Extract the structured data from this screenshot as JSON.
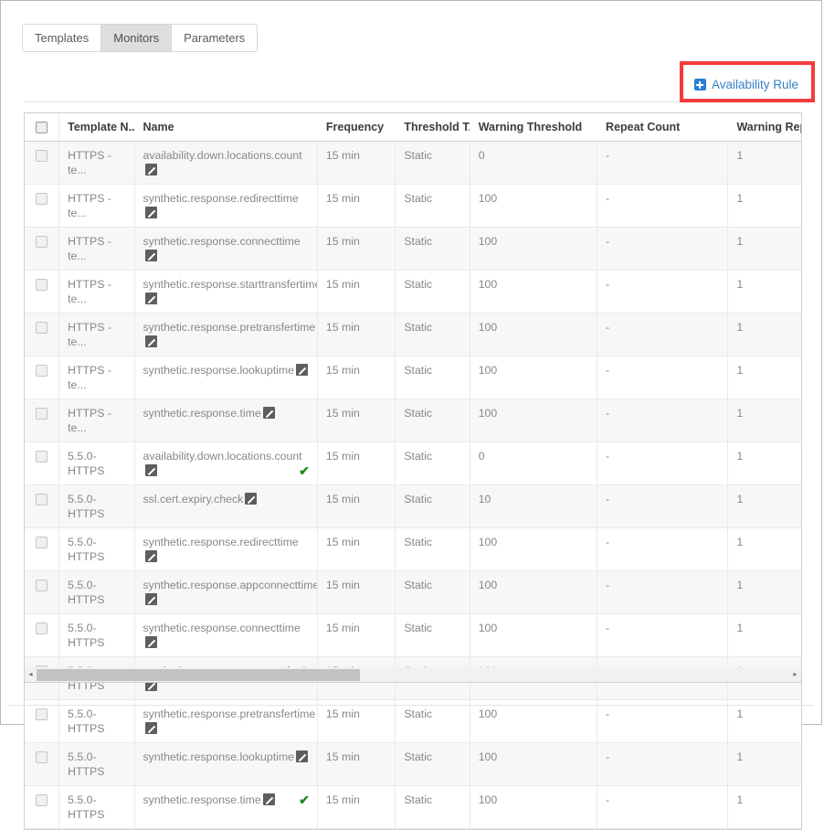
{
  "tabs": [
    {
      "label": "Templates",
      "active": false
    },
    {
      "label": "Monitors",
      "active": true
    },
    {
      "label": "Parameters",
      "active": false
    }
  ],
  "toolbar": {
    "availability_rule_label": "Availability Rule",
    "plus_icon": "plus-square-icon",
    "highlight_color": "#f53b3b",
    "link_color": "#3680c4"
  },
  "table": {
    "columns": [
      {
        "key": "checkbox",
        "label": ""
      },
      {
        "key": "template_name",
        "label": "Template N..."
      },
      {
        "key": "name",
        "label": "Name"
      },
      {
        "key": "frequency",
        "label": "Frequency"
      },
      {
        "key": "threshold_type",
        "label": "Threshold T..."
      },
      {
        "key": "warning_threshold",
        "label": "Warning Threshold"
      },
      {
        "key": "repeat_count",
        "label": "Repeat Count"
      },
      {
        "key": "warning_repeat_count",
        "label": "Warning Repeat C"
      }
    ],
    "rows": [
      {
        "template_name": "HTTPS - te...",
        "name": "availability.down.locations.count",
        "frequency": "15 min",
        "threshold_type": "Static",
        "warning_threshold": "0",
        "repeat_count": "-",
        "warning_repeat_count": "1",
        "checked": false,
        "verified": false
      },
      {
        "template_name": "HTTPS - te...",
        "name": "synthetic.response.redirecttime",
        "frequency": "15 min",
        "threshold_type": "Static",
        "warning_threshold": "100",
        "repeat_count": "-",
        "warning_repeat_count": "1",
        "checked": false,
        "verified": false
      },
      {
        "template_name": "HTTPS - te...",
        "name": "synthetic.response.connecttime",
        "frequency": "15 min",
        "threshold_type": "Static",
        "warning_threshold": "100",
        "repeat_count": "-",
        "warning_repeat_count": "1",
        "checked": false,
        "verified": false
      },
      {
        "template_name": "HTTPS - te...",
        "name": "synthetic.response.starttransfertime",
        "frequency": "15 min",
        "threshold_type": "Static",
        "warning_threshold": "100",
        "repeat_count": "-",
        "warning_repeat_count": "1",
        "checked": false,
        "verified": false
      },
      {
        "template_name": "HTTPS - te...",
        "name": "synthetic.response.pretransfertime",
        "frequency": "15 min",
        "threshold_type": "Static",
        "warning_threshold": "100",
        "repeat_count": "-",
        "warning_repeat_count": "1",
        "checked": false,
        "verified": false
      },
      {
        "template_name": "HTTPS - te...",
        "name": "synthetic.response.lookuptime",
        "frequency": "15 min",
        "threshold_type": "Static",
        "warning_threshold": "100",
        "repeat_count": "-",
        "warning_repeat_count": "1",
        "checked": false,
        "verified": false
      },
      {
        "template_name": "HTTPS - te...",
        "name": "synthetic.response.time",
        "frequency": "15 min",
        "threshold_type": "Static",
        "warning_threshold": "100",
        "repeat_count": "-",
        "warning_repeat_count": "1",
        "checked": false,
        "verified": false
      },
      {
        "template_name": "5.5.0-HTTPS",
        "name": "availability.down.locations.count",
        "frequency": "15 min",
        "threshold_type": "Static",
        "warning_threshold": "0",
        "repeat_count": "-",
        "warning_repeat_count": "1",
        "checked": false,
        "verified": true,
        "verified_position": "below"
      },
      {
        "template_name": "5.5.0-HTTPS",
        "name": "ssl.cert.expiry.check",
        "frequency": "15 min",
        "threshold_type": "Static",
        "warning_threshold": "10",
        "repeat_count": "-",
        "warning_repeat_count": "1",
        "checked": false,
        "verified": false
      },
      {
        "template_name": "5.5.0-HTTPS",
        "name": "synthetic.response.redirecttime",
        "frequency": "15 min",
        "threshold_type": "Static",
        "warning_threshold": "100",
        "repeat_count": "-",
        "warning_repeat_count": "1",
        "checked": false,
        "verified": false
      },
      {
        "template_name": "5.5.0-HTTPS",
        "name": "synthetic.response.appconnecttime",
        "frequency": "15 min",
        "threshold_type": "Static",
        "warning_threshold": "100",
        "repeat_count": "-",
        "warning_repeat_count": "1",
        "checked": false,
        "verified": false
      },
      {
        "template_name": "5.5.0-HTTPS",
        "name": "synthetic.response.connecttime",
        "frequency": "15 min",
        "threshold_type": "Static",
        "warning_threshold": "100",
        "repeat_count": "-",
        "warning_repeat_count": "1",
        "checked": false,
        "verified": false
      },
      {
        "template_name": "5.5.0-HTTPS",
        "name": "synthetic.response.starttransfertime",
        "frequency": "15 min",
        "threshold_type": "Static",
        "warning_threshold": "100",
        "repeat_count": "-",
        "warning_repeat_count": "1",
        "checked": false,
        "verified": false
      },
      {
        "template_name": "5.5.0-HTTPS",
        "name": "synthetic.response.pretransfertime",
        "frequency": "15 min",
        "threshold_type": "Static",
        "warning_threshold": "100",
        "repeat_count": "-",
        "warning_repeat_count": "1",
        "checked": false,
        "verified": false
      },
      {
        "template_name": "5.5.0-HTTPS",
        "name": "synthetic.response.lookuptime",
        "frequency": "15 min",
        "threshold_type": "Static",
        "warning_threshold": "100",
        "repeat_count": "-",
        "warning_repeat_count": "1",
        "checked": false,
        "verified": false
      },
      {
        "template_name": "5.5.0-HTTPS",
        "name": "synthetic.response.time",
        "frequency": "15 min",
        "threshold_type": "Static",
        "warning_threshold": "100",
        "repeat_count": "-",
        "warning_repeat_count": "1",
        "checked": false,
        "verified": true,
        "verified_position": "inline"
      }
    ],
    "edit_icon": "edit-pencil-icon",
    "verified_icon": "checkmark-icon"
  },
  "scrollbar": {
    "left_arrow": "◂",
    "right_arrow": "▸",
    "thumb_percent": 43
  }
}
